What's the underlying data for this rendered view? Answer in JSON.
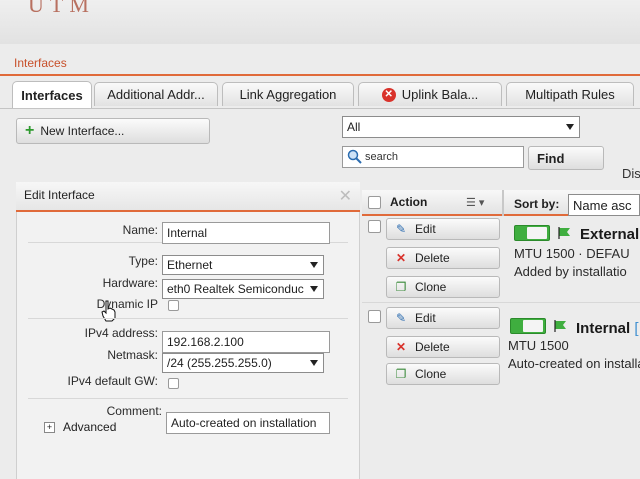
{
  "header": {
    "logo_fragment": "UTM"
  },
  "breadcrumb": {
    "label": "Interfaces"
  },
  "tabs": [
    {
      "label": "Interfaces",
      "active": true
    },
    {
      "label": "Additional Addr..."
    },
    {
      "label": "Link Aggregation"
    },
    {
      "label": "Uplink Bala...",
      "icon": "error-icon"
    },
    {
      "label": "Multipath Rules"
    }
  ],
  "toolbar": {
    "new_interface_label": "New Interface...",
    "filter_select": "All",
    "search_placeholder": "search",
    "find_label": "Find",
    "display_label_fragment": "Dis"
  },
  "edit_panel": {
    "title": "Edit Interface",
    "name_label": "Name:",
    "name_value": "Internal",
    "type_label": "Type:",
    "type_value": "Ethernet",
    "hardware_label": "Hardware:",
    "hardware_value": "eth0 Realtek Semiconduc",
    "dynamic_ip_label": "Dynamic IP",
    "ipv4_label": "IPv4 address:",
    "ipv4_value": "192.168.2.100",
    "netmask_label": "Netmask:",
    "netmask_value": "/24 (255.255.255.0)",
    "gw_label": "IPv4 default GW:",
    "comment_label": "Comment:",
    "comment_value": "Auto-created on installation",
    "advanced_label": "Advanced"
  },
  "grid": {
    "action_header": "Action",
    "sort_label": "Sort by:",
    "sort_value": "Name asc",
    "rows": [
      {
        "edit": "Edit",
        "delete": "Delete",
        "clone": "Clone",
        "name": "External",
        "mtu": "MTU 1500 · DEFAU",
        "comment": "Added by installatio"
      },
      {
        "edit": "Edit",
        "delete": "Delete",
        "clone": "Clone",
        "name": "Internal",
        "name_suffix": "[",
        "mtu": "MTU 1500",
        "comment": "Auto-created on installa"
      }
    ]
  },
  "colors": {
    "accent": "#e06a3a",
    "toggle_on": "#3fae3f",
    "delete_red": "#d9322b"
  }
}
